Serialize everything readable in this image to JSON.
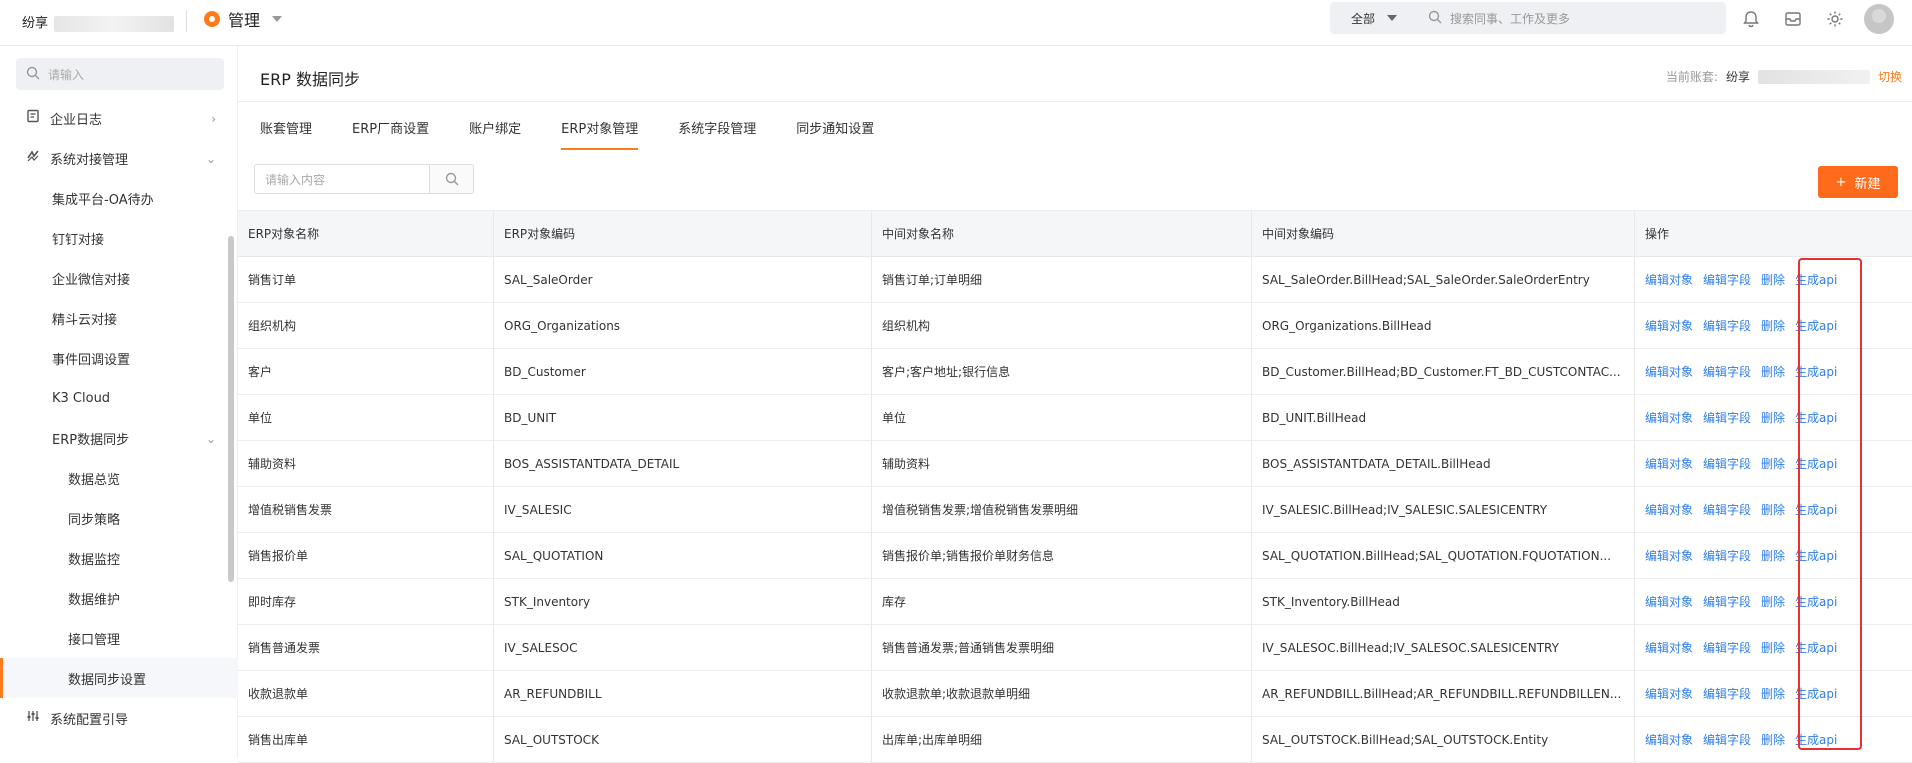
{
  "topbar": {
    "brand_text": "纷享",
    "app_title": "管理",
    "search_scope": "全部",
    "search_placeholder": "搜索同事、工作及更多"
  },
  "sidebar": {
    "search_placeholder": "请输入",
    "items": [
      {
        "label": "企业日志",
        "level": 1,
        "icon": "log-icon"
      },
      {
        "label": "系统对接管理",
        "level": 1,
        "icon": "link-icon"
      },
      {
        "label": "集成平台-OA待办",
        "level": 2
      },
      {
        "label": "钉钉对接",
        "level": 2
      },
      {
        "label": "企业微信对接",
        "level": 2
      },
      {
        "label": "精斗云对接",
        "level": 2
      },
      {
        "label": "事件回调设置",
        "level": 2
      },
      {
        "label": "K3 Cloud",
        "level": 2
      },
      {
        "label": "ERP数据同步",
        "level": 2
      },
      {
        "label": "数据总览",
        "level": 3
      },
      {
        "label": "同步策略",
        "level": 3
      },
      {
        "label": "数据监控",
        "level": 3
      },
      {
        "label": "数据维护",
        "level": 3
      },
      {
        "label": "接口管理",
        "level": 3
      },
      {
        "label": "数据同步设置",
        "level": 3,
        "active": true
      },
      {
        "label": "系统配置引导",
        "level": 1,
        "icon": "settings-sliders-icon"
      }
    ]
  },
  "page": {
    "title": "ERP 数据同步",
    "current_account_label": "当前账套:",
    "current_account_value": "纷享",
    "switch_label": "切换",
    "tabs": [
      "账套管理",
      "ERP厂商设置",
      "账户绑定",
      "ERP对象管理",
      "系统字段管理",
      "同步通知设置"
    ],
    "active_tab_index": 3,
    "filter_placeholder": "请输入内容",
    "new_button_label": "新建"
  },
  "table": {
    "columns": [
      "ERP对象名称",
      "ERP对象编码",
      "中间对象名称",
      "中间对象编码",
      "操作"
    ],
    "actions": [
      "编辑对象",
      "编辑字段",
      "删除",
      "生成api"
    ],
    "rows": [
      [
        "销售订单",
        "SAL_SaleOrder",
        "销售订单;订单明细",
        "SAL_SaleOrder.BillHead;SAL_SaleOrder.SaleOrderEntry"
      ],
      [
        "组织机构",
        "ORG_Organizations",
        "组织机构",
        "ORG_Organizations.BillHead"
      ],
      [
        "客户",
        "BD_Customer",
        "客户;客户地址;银行信息",
        "BD_Customer.BillHead;BD_Customer.FT_BD_CUSTCONTAC..."
      ],
      [
        "单位",
        "BD_UNIT",
        "单位",
        "BD_UNIT.BillHead"
      ],
      [
        "辅助资料",
        "BOS_ASSISTANTDATA_DETAIL",
        "辅助资料",
        "BOS_ASSISTANTDATA_DETAIL.BillHead"
      ],
      [
        "增值税销售发票",
        "IV_SALESIC",
        "增值税销售发票;增值税销售发票明细",
        "IV_SALESIC.BillHead;IV_SALESIC.SALESICENTRY"
      ],
      [
        "销售报价单",
        "SAL_QUOTATION",
        "销售报价单;销售报价单财务信息",
        "SAL_QUOTATION.BillHead;SAL_QUOTATION.FQUOTATION..."
      ],
      [
        "即时库存",
        "STK_Inventory",
        "库存",
        "STK_Inventory.BillHead"
      ],
      [
        "销售普通发票",
        "IV_SALESOC",
        "销售普通发票;普通销售发票明细",
        "IV_SALESOC.BillHead;IV_SALESOC.SALESICENTRY"
      ],
      [
        "收款退款单",
        "AR_REFUNDBILL",
        "收款退款单;收款退款单明细",
        "AR_REFUNDBILL.BillHead;AR_REFUNDBILL.REFUNDBILLEN..."
      ],
      [
        "销售出库单",
        "SAL_OUTSTOCK",
        "出库单;出库单明细",
        "SAL_OUTSTOCK.BillHead;SAL_OUTSTOCK.Entity"
      ]
    ]
  },
  "colors": {
    "accent": "#ff7a1a",
    "link": "#2f7ee8",
    "highlight": "#e83030"
  }
}
